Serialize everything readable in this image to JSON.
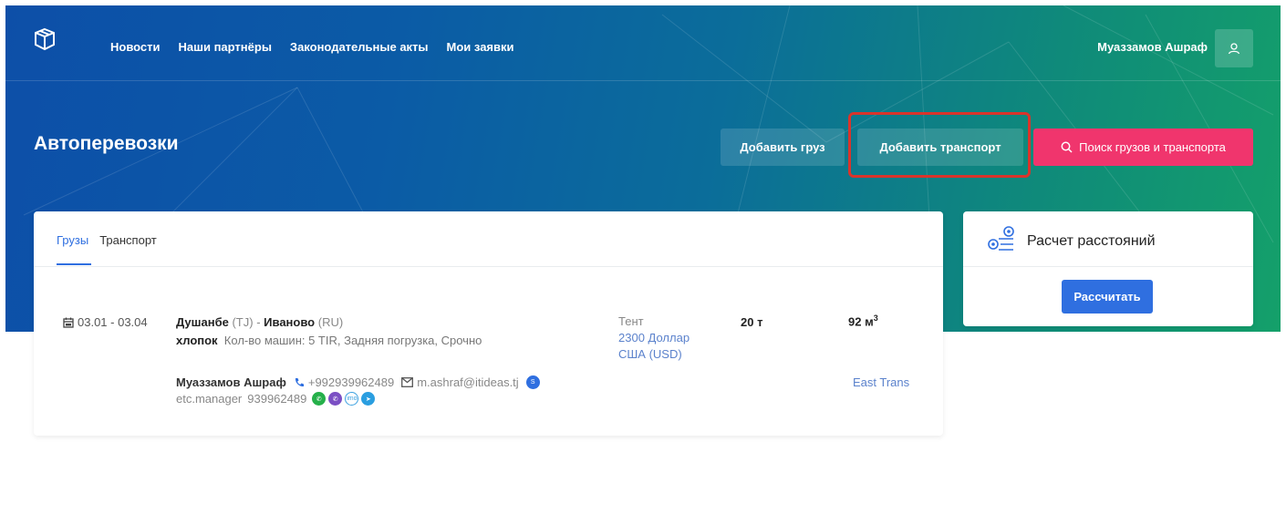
{
  "nav": {
    "links": [
      "Новости",
      "Наши партнёры",
      "Законодательные акты",
      "Мои заявки"
    ],
    "user_name": "Муаззамов Ашраф"
  },
  "header": {
    "title": "Автоперевозки",
    "add_cargo": "Добавить груз",
    "add_transport": "Добавить транспорт",
    "search": "Поиск грузов и транспорта"
  },
  "tabs": [
    "Грузы",
    "Транспорт"
  ],
  "listing": {
    "date": "03.01 - 03.04",
    "from_city": "Душанбе",
    "from_country": "(TJ)",
    "route_sep": "-",
    "to_city": "Иваново",
    "to_country": "(RU)",
    "cargo": "хлопок",
    "details": "Кол-во машин: 5   TIR, Задняя погрузка, Срочно",
    "body_type": "Тент",
    "price": "2300 Доллар США (USD)",
    "weight": "20 т",
    "volume": "92 м",
    "volume_unit_sup": "3",
    "contact_name": "Муаззамов Ашраф",
    "phone": "+992939962489",
    "email": "m.ashraf@itideas.tj",
    "skype": "etc.manager",
    "messenger_phone": "939962489",
    "company": "East Trans"
  },
  "distance": {
    "title": "Расчет расстояний",
    "button": "Рассчитать"
  },
  "colors": {
    "accent_blue": "#2f6fe0",
    "search_pink": "#f0356d",
    "highlight_red": "#d9342b"
  }
}
